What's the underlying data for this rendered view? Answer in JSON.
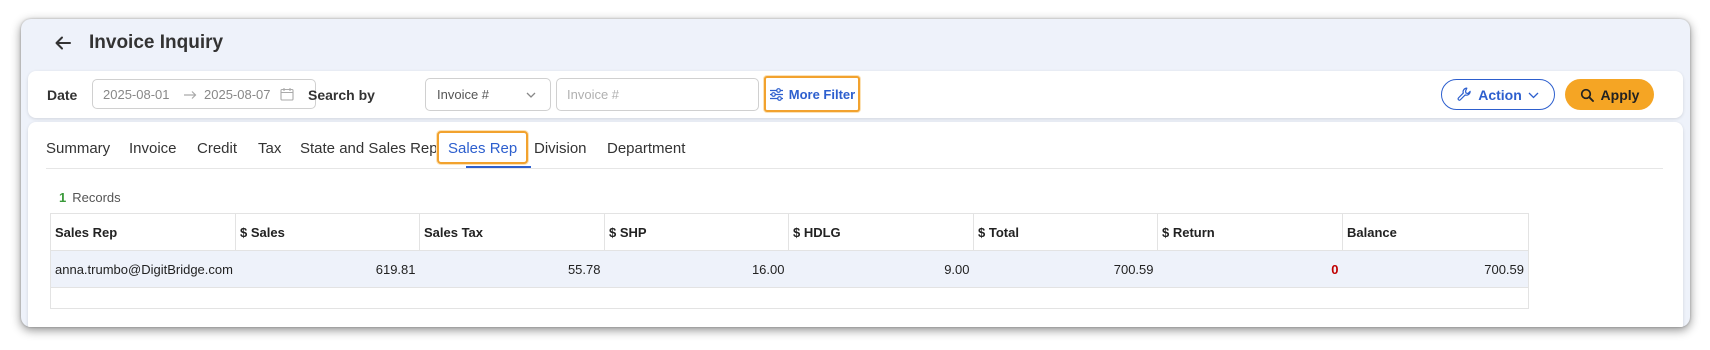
{
  "page": {
    "title": "Invoice Inquiry"
  },
  "filters": {
    "date_label": "Date",
    "date_from": "2025-08-01",
    "date_to": "2025-08-07",
    "search_by_label": "Search by",
    "search_type": "Invoice #",
    "search_placeholder": "Invoice #",
    "more_filter_label": "More Filter",
    "action_label": "Action",
    "apply_label": "Apply"
  },
  "tabs": [
    {
      "label": "Summary"
    },
    {
      "label": "Invoice"
    },
    {
      "label": "Credit"
    },
    {
      "label": "Tax"
    },
    {
      "label": "State and Sales Rep"
    },
    {
      "label": "Sales Rep",
      "active": true
    },
    {
      "label": "Division"
    },
    {
      "label": "Department"
    }
  ],
  "records": {
    "count": "1",
    "label": "Records"
  },
  "table": {
    "columns": [
      "Sales Rep",
      "$ Sales",
      "Sales Tax",
      "$ SHP",
      "$ HDLG",
      "$ Total",
      "$ Return",
      "Balance"
    ],
    "rows": [
      [
        "anna.trumbo@DigitBridge.com",
        "619.81",
        "55.78",
        "16.00",
        "9.00",
        "700.59",
        "0",
        "700.59"
      ]
    ]
  },
  "colors": {
    "accent": "#2d5fce",
    "highlight": "#f2a22e",
    "apply": "#f5a524",
    "negative": "#c00000",
    "count": "#3a9a3a"
  },
  "icons": [
    "arrow-left-icon",
    "arrow-right-icon",
    "calendar-icon",
    "chevron-down-icon",
    "sliders-icon",
    "wrench-icon",
    "search-icon"
  ]
}
